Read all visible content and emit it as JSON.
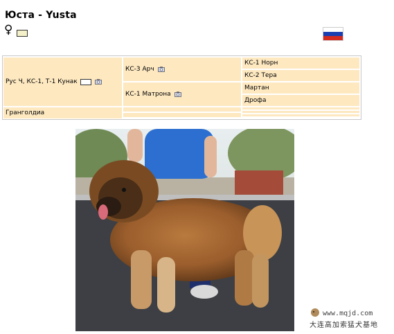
{
  "header": {
    "title": "Юста - Yusta",
    "sex_symbol": "♀",
    "color_swatch": "#f4f1c8",
    "flag_colors": [
      "#ffffff",
      "#1a3fb0",
      "#d52b1e"
    ]
  },
  "pedigree": {
    "sire": "Рус Ч, КС-1, Т-1 Кунак",
    "dam": "Гранголдиа",
    "sire_sire": "КС-3 Арч",
    "sire_dam": "КС-1 Матрона",
    "sire_sire_sire": "КС-1 Норн",
    "sire_sire_dam": "КС-2 Тера",
    "sire_dam_sire": "Мартан",
    "sire_dam_dam": "Дрофа",
    "cell_color": "#fde8c0",
    "icon": "camera-icon"
  },
  "watermark": {
    "url": "www.mqjd.com",
    "site": "大连高加索猛犬基地"
  }
}
